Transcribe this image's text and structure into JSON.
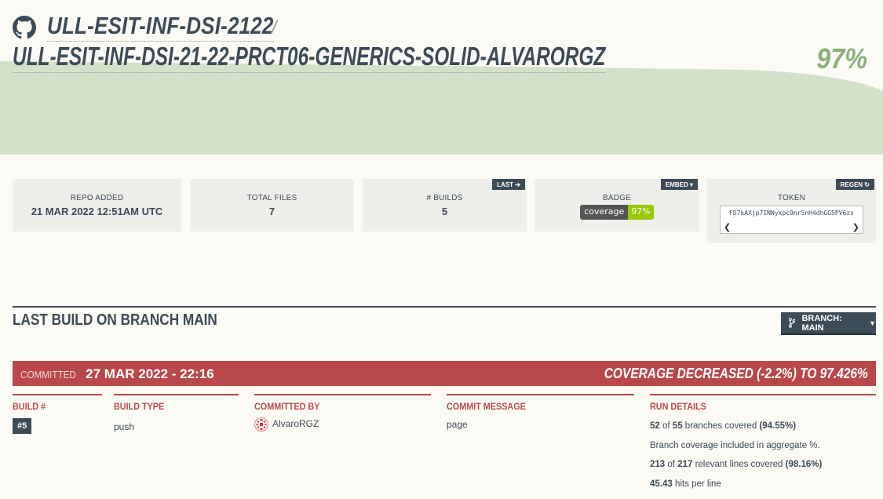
{
  "header": {
    "owner": "ULL-ESIT-INF-DSI-2122",
    "separator": "/",
    "repo": "ULL-ESIT-INF-DSI-21-22-PRCT06-GENERICS-SOLID-ALVARORGZ",
    "coverage": "97%"
  },
  "colors": {
    "accent": "#3d4b57",
    "coverage_bg": "#d3e1c9",
    "coverage_text": "#8cb07c",
    "decrease": "#b9484a",
    "badge_green": "#97ca00"
  },
  "stats": {
    "repo_added": {
      "label": "REPO ADDED",
      "value": "21 MAR 2022 12:51AM UTC"
    },
    "total_files": {
      "label": "TOTAL FILES",
      "value": "7"
    },
    "builds": {
      "label": "# BUILDS",
      "value": "5",
      "tag": "LAST"
    },
    "badge": {
      "label": "BADGE",
      "tag": "EMBED",
      "left": "coverage",
      "right": "97%"
    },
    "token": {
      "label": "TOKEN",
      "tag": "REGEN",
      "value": "FD7kAXjp7INNykpc9nr5nH4dhGG5PV6zs"
    }
  },
  "last_build": {
    "title": "LAST BUILD ON BRANCH MAIN",
    "branch_button": "BRANCH: MAIN",
    "committed_label": "COMMITTED",
    "committed_date": "27 MAR 2022 - 22:16",
    "coverage_change": "COVERAGE DECREASED (-2.2%) TO 97.426%",
    "columns": {
      "build_no": {
        "header": "BUILD #",
        "value": "#5"
      },
      "build_type": {
        "header": "BUILD TYPE",
        "value": "push"
      },
      "committed_by": {
        "header": "COMMITTED BY",
        "value": "AlvaroRGZ"
      },
      "commit_message": {
        "header": "COMMIT MESSAGE",
        "value": "page"
      },
      "run_details": {
        "header": "RUN DETAILS",
        "branches_covered": "52",
        "branches_total": "55",
        "branches_text": "branches covered",
        "branches_pct": "(94.55%)",
        "aggregate_note": "Branch coverage included in aggregate %.",
        "lines_covered": "213",
        "lines_total": "217",
        "lines_text": "relevant lines covered",
        "lines_pct": "(98.16%)",
        "hits": "45.43",
        "hits_text": "hits per line",
        "of": "of"
      }
    }
  }
}
